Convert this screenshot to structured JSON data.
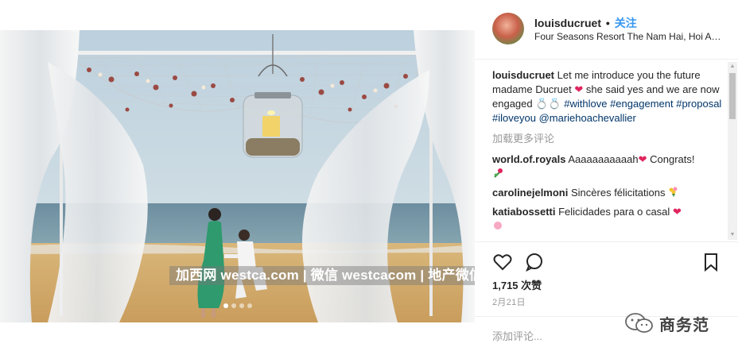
{
  "post": {
    "username": "louisducruet",
    "separator": "•",
    "follow_label": "关注",
    "location": "Four Seasons Resort The Nam Hai, Hoi An,...",
    "caption": {
      "username": "louisducruet",
      "text_1": "Let me introduce you the future madame Ducruet",
      "heart": "❤",
      "text_2": "she said yes and we are now engaged",
      "rings": "💍💍",
      "hashtags": [
        "#withlove",
        "#engagement",
        "#proposal",
        "#iloveyou"
      ],
      "mention": "@mariehoachevallier"
    },
    "load_more_label": "加载更多评论",
    "comments": [
      {
        "username": "world.of.royals",
        "text": "Aaaaaaaaaaah",
        "suffix": "Congrats!",
        "heart": "❤"
      },
      {
        "username": "carolinejelmoni",
        "text": "Sincères félicitations"
      },
      {
        "username": "katiabossetti",
        "text": "Felicidades para o casal",
        "heart": "❤"
      }
    ],
    "likes": "1,715 次赞",
    "date": "2月21日",
    "add_comment_placeholder": "添加评论..."
  },
  "watermark": "加西网 westca.com | 微信 westcacom | 地产微信 westcahouse",
  "wechat_account": "商务范",
  "carousel": {
    "count": 4,
    "active_index": 0
  },
  "colors": {
    "link": "#3897f0",
    "hashtag": "#003569",
    "muted": "#999999",
    "heart": "#e0245e"
  },
  "icons": [
    "heart-outline-icon",
    "comment-icon",
    "bookmark-icon",
    "wechat-icon"
  ]
}
